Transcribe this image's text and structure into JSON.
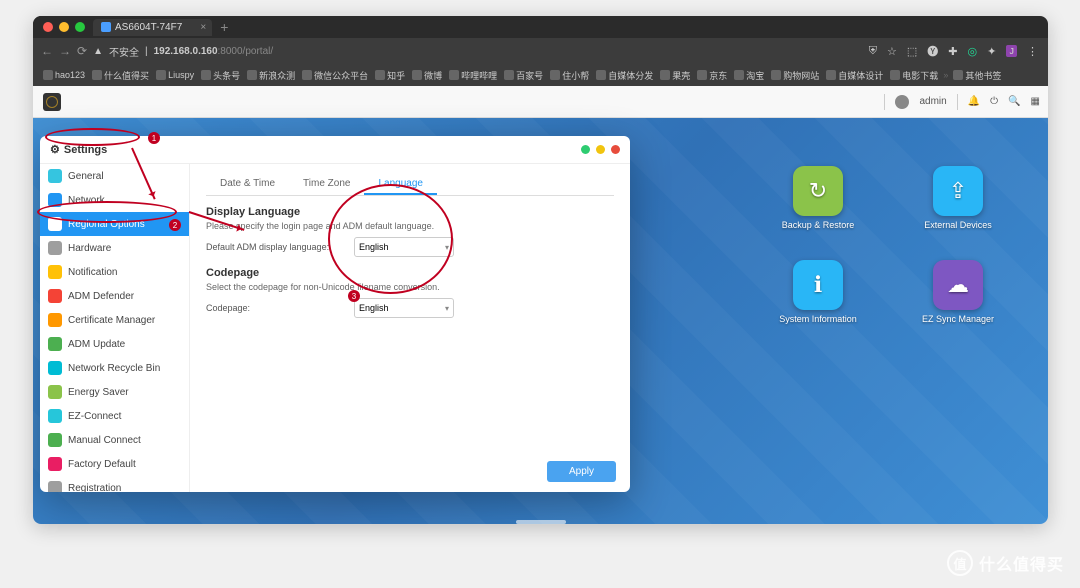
{
  "browser": {
    "tab_title": "AS6604T-74F7",
    "security": "不安全",
    "url_host": "192.168.0.160",
    "url_path": ":8000/portal/"
  },
  "bookmarks": [
    "hao123",
    "什么值得买",
    "Liuspy",
    "头条号",
    "新浪众测",
    "微信公众平台",
    "知乎",
    "微博",
    "哔哩哔哩",
    "百家号",
    "住小帮",
    "自媒体分发",
    "果壳",
    "京东",
    "淘宝",
    "购物网站",
    "自媒体设计",
    "电影下载",
    "其他书签"
  ],
  "adm": {
    "user": "admin"
  },
  "settings": {
    "title": "Settings",
    "sidebar": [
      {
        "label": "General",
        "c": "#35c5e0"
      },
      {
        "label": "Network",
        "c": "#2196f3"
      },
      {
        "label": "Regional Options",
        "c": "#ffffff",
        "active": true
      },
      {
        "label": "Hardware",
        "c": "#9e9e9e"
      },
      {
        "label": "Notification",
        "c": "#ffc107"
      },
      {
        "label": "ADM Defender",
        "c": "#f44336"
      },
      {
        "label": "Certificate Manager",
        "c": "#ff9800"
      },
      {
        "label": "ADM Update",
        "c": "#4caf50"
      },
      {
        "label": "Network Recycle Bin",
        "c": "#00bcd4"
      },
      {
        "label": "Energy Saver",
        "c": "#8bc34a"
      },
      {
        "label": "EZ-Connect",
        "c": "#26c6da"
      },
      {
        "label": "Manual Connect",
        "c": "#4caf50"
      },
      {
        "label": "Factory Default",
        "c": "#e91e63"
      },
      {
        "label": "Registration",
        "c": "#9e9e9e"
      }
    ],
    "tabs": [
      "Date & Time",
      "Time Zone",
      "Language"
    ],
    "tab_active": 2,
    "s1": {
      "h": "Display Language",
      "p": "Please specify the login page and ADM default language.",
      "lab": "Default ADM display language:",
      "val": "English"
    },
    "s2": {
      "h": "Codepage",
      "p": "Select the codepage for non-Unicode filename conversion.",
      "lab": "Codepage:",
      "val": "English"
    },
    "apply": "Apply"
  },
  "desktop_icons": [
    {
      "label": "Backup & Restore",
      "c": "#8bc34a"
    },
    {
      "label": "External Devices",
      "c": "#29b6f6"
    },
    {
      "label": "System Information",
      "c": "#29b6f6"
    },
    {
      "label": "EZ Sync Manager",
      "c": "#7e57c2"
    }
  ],
  "watermark": {
    "icon": "值",
    "text": "什么值得买"
  }
}
